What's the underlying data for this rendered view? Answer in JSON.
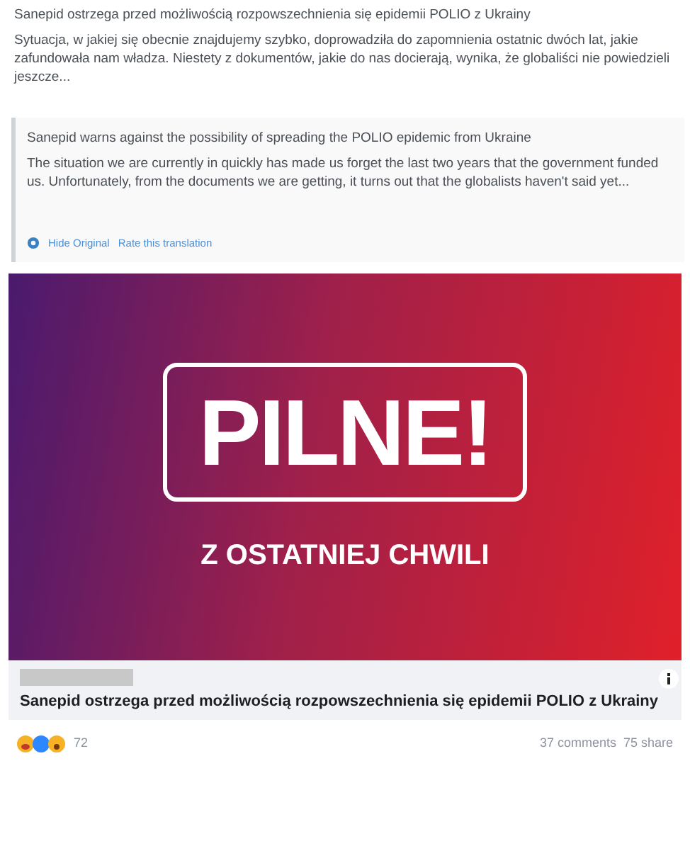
{
  "post": {
    "title": "Sanepid ostrzega przed możliwością rozpowszechnienia się epidemii POLIO z Ukrainy",
    "body": "Sytuacja, w jakiej się obecnie znajdujemy szybko, doprowadziła do zapomnienia ostatnic dwóch lat, jakie zafundowała nam władza. Niestety z dokumentów, jakie do nas docierają, wynika, że globaliści nie powiedzieli jeszcze..."
  },
  "translation": {
    "title": "Sanepid warns against the possibility of spreading the POLIO epidemic from Ukraine",
    "body": "The situation we are currently in quickly has made us forget the last two years that the government funded us. Unfortunately, from the documents we are getting, it turns out that the globalists haven't said yet...",
    "links": [
      "Hide Original",
      "Rate this translation"
    ]
  },
  "banner": {
    "headline": "PILNE!",
    "subtitle": "Z OSTATNIEJ CHWILI"
  },
  "link_preview": {
    "title": "Sanepid ostrzega przed możliwością rozpowszechnienia się epidemii POLIO z Ukrainy"
  },
  "footer": {
    "reaction_count": "72",
    "comments": "37 comments",
    "shares": "75 share"
  }
}
